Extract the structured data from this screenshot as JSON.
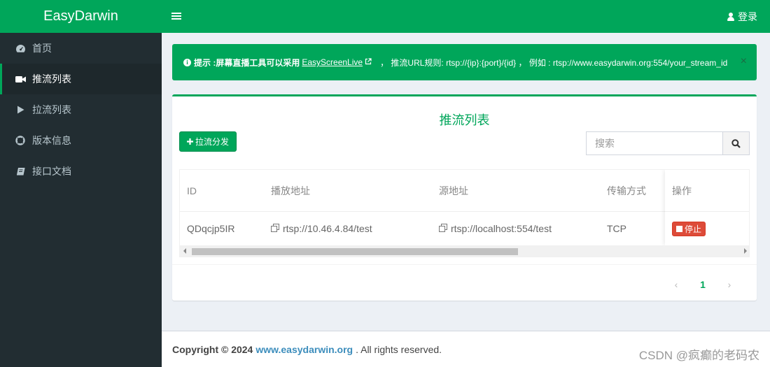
{
  "app": {
    "logo": "EasyDarwin",
    "login_label": "登录"
  },
  "sidebar": {
    "items": [
      {
        "label": "首页",
        "icon": "dashboard-icon"
      },
      {
        "label": "推流列表",
        "icon": "video-camera-icon",
        "active": true
      },
      {
        "label": "拉流列表",
        "icon": "play-icon"
      },
      {
        "label": "版本信息",
        "icon": "life-ring-icon"
      },
      {
        "label": "接口文档",
        "icon": "book-icon"
      }
    ]
  },
  "alert": {
    "prefix": "提示 :",
    "text1": "屏幕直播工具可以采用",
    "link": "EasyScreenLive",
    "text2": "，  推流URL规则: rtsp://{ip}:{port}/{id} ，  例如 : rtsp://www.easydarwin.org:554/your_stream_id",
    "close": "×"
  },
  "box": {
    "title": "推流列表",
    "pull_button": "拉流分发",
    "search_placeholder": "搜索"
  },
  "table": {
    "headers": [
      "ID",
      "播放地址",
      "源地址",
      "传输方式",
      "操作"
    ],
    "rows": [
      {
        "id": "QDqcjp5IR",
        "play_url": "rtsp://10.46.4.84/test",
        "source_url": "rtsp://localhost:554/test",
        "transport": "TCP",
        "action": "停止"
      }
    ]
  },
  "pagination": {
    "prev": "‹",
    "current": "1",
    "next": "›"
  },
  "footer": {
    "copyright": "Copyright © 2024",
    "link": "www.easydarwin.org",
    "rest": ". All rights reserved.",
    "watermark": "CSDN @疯癫的老码农"
  },
  "colors": {
    "brand": "#00a65a",
    "sidebar": "#222d32",
    "danger": "#dd4b39",
    "link": "#3c8dbc"
  }
}
